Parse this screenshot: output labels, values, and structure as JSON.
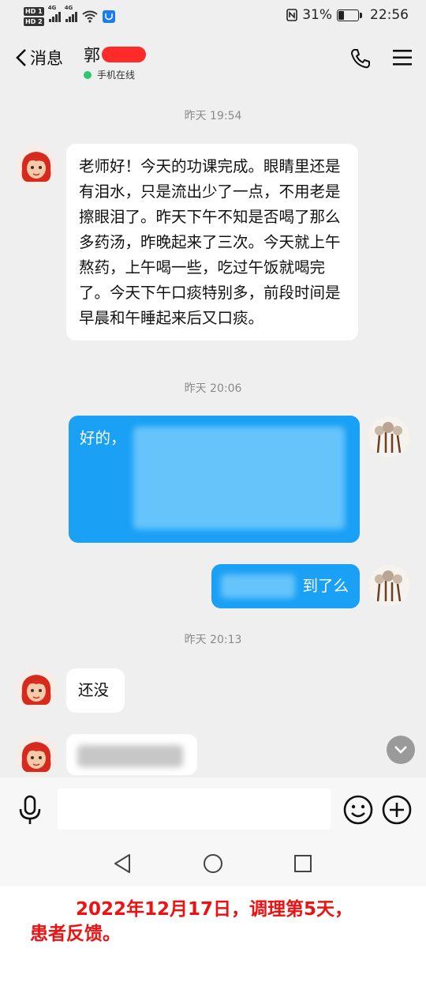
{
  "status_bar": {
    "hd1": "HD 1",
    "hd2": "HD 2",
    "net1": "4G",
    "net2": "4G",
    "battery_percent": "31%",
    "battery_level": 0.31,
    "time": "22:56"
  },
  "header": {
    "back_label": "消息",
    "contact_name": "郭",
    "online_status": "手机在线"
  },
  "messages": [
    {
      "type": "time",
      "text": "昨天 19:54"
    },
    {
      "type": "incoming",
      "text": "老师好！今天的功课完成。眼睛里还是有泪水，只是流出少了一点，不用老是擦眼泪了。昨天下午不知是否喝了那么多药汤，昨晚起来了三次。今天就上午熬药，上午喝一些，吃过午饭就喝完了。今天下午口痰特别多，前段时间是早晨和午睡起来后又口痰。"
    },
    {
      "type": "time",
      "text": "昨天 20:06"
    },
    {
      "type": "outgoing",
      "text": "好的，"
    },
    {
      "type": "outgoing",
      "text": "到了么"
    },
    {
      "type": "time",
      "text": "昨天 20:13"
    },
    {
      "type": "incoming",
      "text": "还没"
    },
    {
      "type": "incoming",
      "text": ""
    }
  ],
  "caption": {
    "line1": "2022年12月17日，调理第5天，",
    "line2": "患者反馈。"
  },
  "colors": {
    "outgoing_bubble": "#1aa0f5",
    "incoming_bubble": "#ffffff",
    "chat_background": "#efefef",
    "online_dot": "#2dc76d",
    "caption_text": "#ee1111"
  },
  "icons": [
    "chevron-left-icon",
    "phone-icon",
    "menu-icon",
    "mic-icon",
    "emoji-icon",
    "plus-icon",
    "nav-back-icon",
    "nav-home-icon",
    "nav-recent-icon",
    "chevron-down-icon"
  ]
}
